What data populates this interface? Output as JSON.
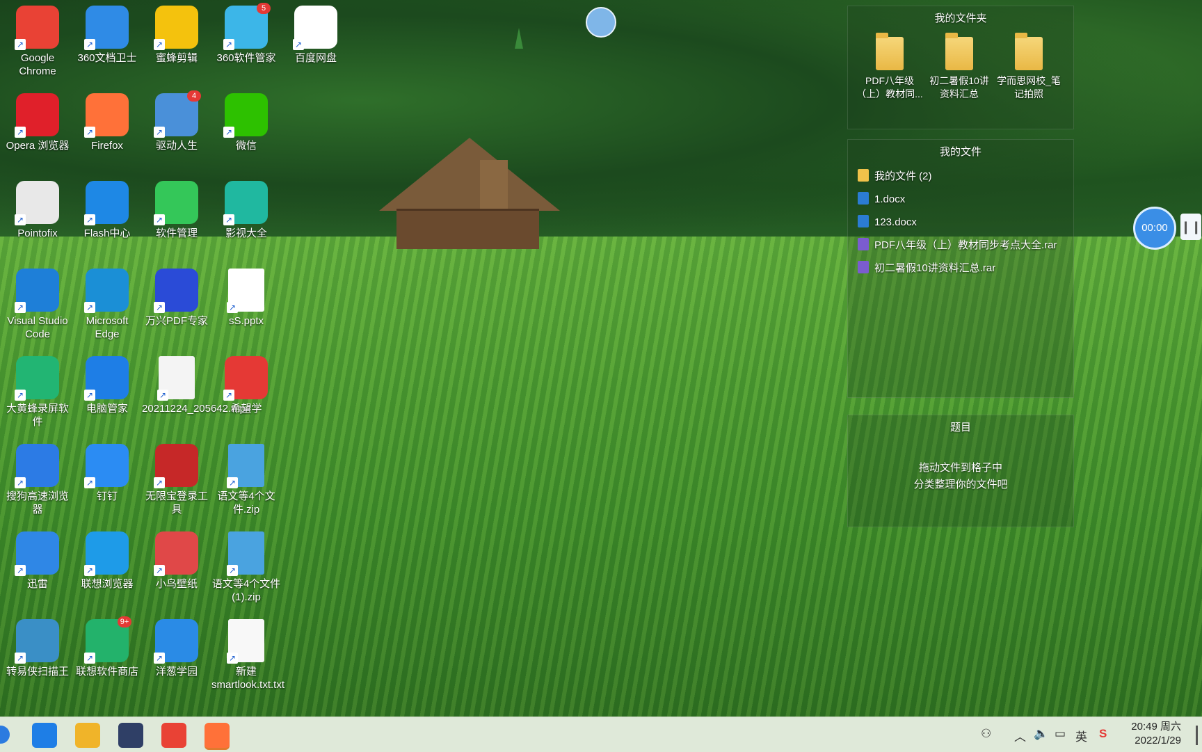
{
  "desktop_icons": [
    {
      "label": "Google Chrome",
      "icon": "chrome-icon",
      "color": "#e94235",
      "col": 0,
      "row": 0
    },
    {
      "label": "360文档卫士",
      "icon": "shield-icon",
      "color": "#2f8be6",
      "col": 1,
      "row": 0
    },
    {
      "label": "蜜蜂剪辑",
      "icon": "bee-icon",
      "color": "#f4c20d",
      "col": 2,
      "row": 0
    },
    {
      "label": "360软件管家",
      "icon": "apps-icon",
      "color": "#3cb6e8",
      "col": 3,
      "row": 0,
      "badge": "5"
    },
    {
      "label": "百度网盘",
      "icon": "cloud-icon",
      "color": "#ffffff",
      "col": 4,
      "row": 0
    },
    {
      "label": "Opera 浏览器",
      "icon": "opera-icon",
      "color": "#e0202a",
      "col": 0,
      "row": 1
    },
    {
      "label": "Firefox",
      "icon": "firefox-icon",
      "color": "#ff7139",
      "col": 1,
      "row": 1
    },
    {
      "label": "驱动人生",
      "icon": "gear-icon",
      "color": "#4a90d9",
      "col": 2,
      "row": 1,
      "badge": "4"
    },
    {
      "label": "微信",
      "icon": "wechat-icon",
      "color": "#2dc100",
      "col": 3,
      "row": 1
    },
    {
      "label": "Pointofix",
      "icon": "pointer-icon",
      "color": "#e8e8e8",
      "col": 0,
      "row": 2
    },
    {
      "label": "Flash中心",
      "icon": "flash-icon",
      "color": "#1e88e5",
      "col": 1,
      "row": 2
    },
    {
      "label": "软件管理",
      "icon": "flower-icon",
      "color": "#34c759",
      "col": 2,
      "row": 2
    },
    {
      "label": "影视大全",
      "icon": "play-icon",
      "color": "#20b8a0",
      "col": 3,
      "row": 2
    },
    {
      "label": "Visual Studio Code",
      "icon": "vscode-icon",
      "color": "#1e7fd8",
      "col": 0,
      "row": 3
    },
    {
      "label": "Microsoft Edge",
      "icon": "edge-icon",
      "color": "#1b8fd6",
      "col": 1,
      "row": 3
    },
    {
      "label": "万兴PDF专家",
      "icon": "pdf-icon",
      "color": "#2a4bd7",
      "col": 2,
      "row": 3
    },
    {
      "label": "sS.pptx",
      "icon": "pptx-icon",
      "color": "#ffffff",
      "col": 3,
      "row": 3
    },
    {
      "label": "大黄蜂录屏软件",
      "icon": "recorder-icon",
      "color": "#22b573",
      "col": 0,
      "row": 4
    },
    {
      "label": "电脑管家",
      "icon": "guard-icon",
      "color": "#1e7ee6",
      "col": 1,
      "row": 4
    },
    {
      "label": "20211224_205642.mp4",
      "icon": "video-thumbnail-icon",
      "color": "#f4f4f4",
      "col": 2,
      "row": 4
    },
    {
      "label": "希望学",
      "icon": "xue-icon",
      "color": "#e53935",
      "col": 3,
      "row": 4
    },
    {
      "label": "搜狗高速浏览器",
      "icon": "sogou-icon",
      "color": "#2c7be5",
      "col": 0,
      "row": 5
    },
    {
      "label": "钉钉",
      "icon": "dingtalk-icon",
      "color": "#2b8cf3",
      "col": 1,
      "row": 5
    },
    {
      "label": "无限宝登录工具",
      "icon": "seal-icon",
      "color": "#c62828",
      "col": 2,
      "row": 5
    },
    {
      "label": "语文等4个文件.zip",
      "icon": "zip-icon",
      "color": "#4aa3e0",
      "col": 3,
      "row": 5
    },
    {
      "label": "迅雷",
      "icon": "bird-icon",
      "color": "#2f87e6",
      "col": 0,
      "row": 6
    },
    {
      "label": "联想浏览器",
      "icon": "lenovo-browser-icon",
      "color": "#1e9be8",
      "col": 1,
      "row": 6
    },
    {
      "label": "小鸟壁纸",
      "icon": "parrot-icon",
      "color": "#e04848",
      "col": 2,
      "row": 6
    },
    {
      "label": "语文等4个文件 (1).zip",
      "icon": "zip-icon",
      "color": "#4aa3e0",
      "col": 3,
      "row": 6
    },
    {
      "label": "转易侠扫描王",
      "icon": "scanner-icon",
      "color": "#3a8fc6",
      "col": 0,
      "row": 7
    },
    {
      "label": "联想软件商店",
      "icon": "store-icon",
      "color": "#23b26b",
      "col": 1,
      "row": 7,
      "badge": "9+"
    },
    {
      "label": "洋葱学园",
      "icon": "onion-icon",
      "color": "#2a8be6",
      "col": 2,
      "row": 7
    },
    {
      "label": "新建smartlook.txt.txt",
      "icon": "text-file-icon",
      "color": "#f8f8f8",
      "col": 3,
      "row": 7
    }
  ],
  "panel": {
    "folders_title": "我的文件夹",
    "folders": [
      {
        "label": "PDF八年级（上）教材同..."
      },
      {
        "label": "初二暑假10讲资料汇总"
      },
      {
        "label": "学而思网校_笔记拍照"
      }
    ],
    "files_title": "我的文件",
    "files": [
      {
        "label": "我的文件 (2)",
        "icon": "folder-icon",
        "color": "#f0c24a"
      },
      {
        "label": "1.docx",
        "icon": "docx-icon",
        "color": "#2b7cd3"
      },
      {
        "label": "123.docx",
        "icon": "docx-icon",
        "color": "#2b7cd3"
      },
      {
        "label": "PDF八年级（上）教材同步考点大全.rar",
        "icon": "rar-icon",
        "color": "#7b5ccf"
      },
      {
        "label": "初二暑假10讲资料汇总.rar",
        "icon": "rar-icon",
        "color": "#7b5ccf"
      }
    ],
    "topic_title": "题目",
    "topic_hint_line1": "拖动文件到格子中",
    "topic_hint_line2": "分类整理你的文件吧"
  },
  "timer": {
    "time": "00:00",
    "pause_icon": "pause-icon"
  },
  "taskbar": {
    "apps": [
      {
        "name": "lenovo-l-icon",
        "color": "#1e7ee6"
      },
      {
        "name": "file-explorer-icon",
        "color": "#f0b429"
      },
      {
        "name": "devexpress-icon",
        "color": "#2f3f66"
      },
      {
        "name": "chrome-icon",
        "color": "#e94235"
      },
      {
        "name": "firefox-icon",
        "color": "#ff7139"
      }
    ],
    "ime": "英",
    "time": "20:49 周六",
    "date": "2022/1/29"
  }
}
